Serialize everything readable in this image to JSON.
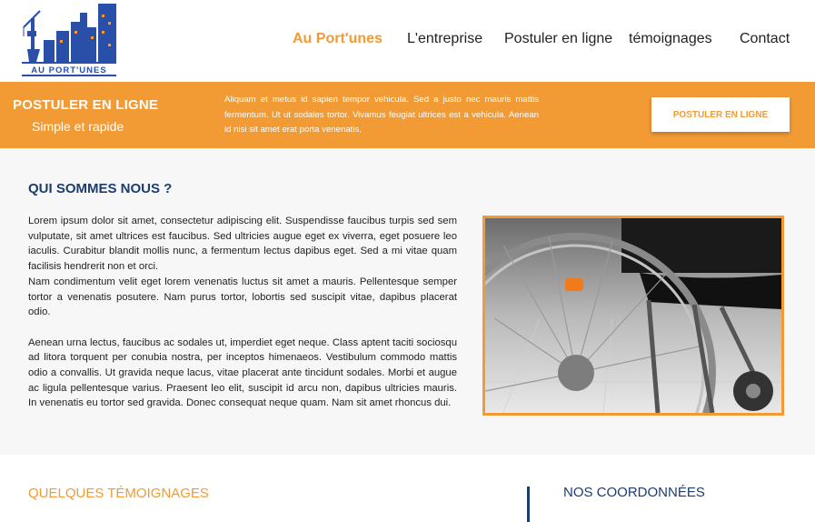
{
  "header": {
    "logo_text": "AU PORT'UNES",
    "nav": [
      {
        "label": "Au Port'unes",
        "active": true
      },
      {
        "label": "L'entreprise",
        "active": false
      },
      {
        "label": "Postuler en ligne",
        "active": false
      },
      {
        "label": "témoignages",
        "active": false
      },
      {
        "label": "Contact",
        "active": false
      }
    ]
  },
  "banner": {
    "title": "POSTULER EN LIGNE",
    "subtitle": "Simple et rapide",
    "text": "Aliquam et metus id sapien tempor vehicula. Sed a justo nec mauris mattis fermentum. Ut ut sodales tortor. Vivamus feugiat ultrices est a vehicula. Aenean id nisi sit amet erat porta venenatis.",
    "button_label": "POSTULER EN LIGNE"
  },
  "about": {
    "title": "QUI SOMMES NOUS ?",
    "paragraphs": [
      "Lorem ipsum dolor sit amet, consectetur adipiscing elit. Suspendisse faucibus turpis sed sem vulputate, sit amet ultrices est faucibus. Sed ultricies augue eget ex viverra, eget posuere leo iaculis. Curabitur blandit mollis nunc, a fermentum lectus dapibus eget. Sed a mi vitae quam facilisis hendrerit non et orci.",
      "Nam condimentum velit eget lorem venenatis luctus sit amet a mauris. Pellentesque semper tortor a venenatis posutere. Nam purus tortor, lobortis sed suscipit vitae, dapibus placerat odio.",
      "Aenean urna lectus, faucibus ac sodales ut, imperdiet eget neque. Class aptent taciti sociosqu ad litora torquent per conubia nostra, per inceptos himenaeos. Vestibulum commodo mattis odio a convallis. Ut gravida neque lacus, vitae placerat ante tincidunt sodales. Morbi et augue ac ligula pellentesque varius. Praesent leo elit, suscipit id arcu non, dapibus ultricies mauris. In venenatis eu tortor sed gravida. Donec consequat neque quam. Nam sit amet rhoncus dui."
    ]
  },
  "bottom": {
    "testimonials_title": "QUELQUES TÉMOIGNAGES",
    "contact_title": "NOS COORDONNÉES"
  },
  "colors": {
    "accent": "#f29a34",
    "navy": "#1c3d6e"
  }
}
